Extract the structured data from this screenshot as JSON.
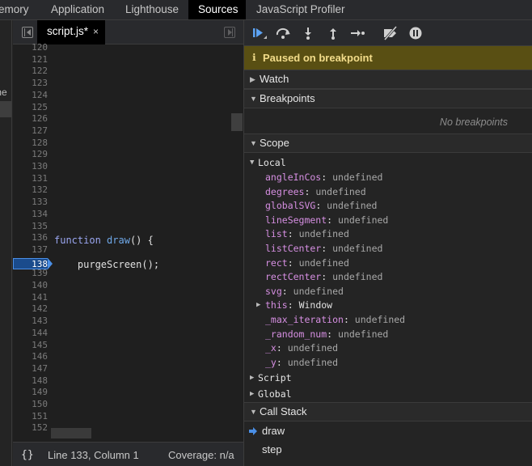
{
  "top_tabs": [
    {
      "label": "emory",
      "active": false
    },
    {
      "label": "Application",
      "active": false
    },
    {
      "label": "Lighthouse",
      "active": false
    },
    {
      "label": "Sources",
      "active": true
    },
    {
      "label": "JavaScript Profiler",
      "active": false
    }
  ],
  "left_fragment": "me",
  "editor": {
    "file_tab": "script.js*",
    "file_tab_close": "×",
    "line_numbers": [
      "120",
      "121",
      "122",
      "123",
      "124",
      "125",
      "126",
      "127",
      "128",
      "129",
      "130",
      "131",
      "132",
      "133",
      "134",
      "135",
      "136",
      "137",
      "138",
      "139",
      "140",
      "141",
      "142",
      "143",
      "144",
      "145",
      "146",
      "147",
      "148",
      "149",
      "150",
      "151",
      "152"
    ],
    "breakpoint_line": "138",
    "code": {
      "line136": {
        "kw": "function",
        "fn": "draw",
        "rest": "() {"
      },
      "line138": {
        "text": "    purgeScreen();"
      }
    }
  },
  "status": {
    "braces": "{}",
    "position": "Line 133, Column 1",
    "coverage": "Coverage: n/a"
  },
  "debugger": {
    "toolbar_icons": [
      "resume-icon",
      "step-over-icon",
      "step-into-icon",
      "step-out-icon",
      "step-icon",
      "deactivate-breakpoints-icon",
      "pause-on-exceptions-icon"
    ],
    "paused_icon": "ℹ",
    "paused_text": "Paused on breakpoint",
    "watch_label": "Watch",
    "breakpoints_label": "Breakpoints",
    "no_breakpoints": "No breakpoints",
    "scope_label": "Scope",
    "local_label": "Local",
    "local_vars": [
      {
        "name": "angleInCos",
        "value": "undefined"
      },
      {
        "name": "degrees",
        "value": "undefined"
      },
      {
        "name": "globalSVG",
        "value": "undefined"
      },
      {
        "name": "lineSegment",
        "value": "undefined"
      },
      {
        "name": "list",
        "value": "undefined"
      },
      {
        "name": "listCenter",
        "value": "undefined"
      },
      {
        "name": "rect",
        "value": "undefined"
      },
      {
        "name": "rectCenter",
        "value": "undefined"
      },
      {
        "name": "svg",
        "value": "undefined"
      },
      {
        "name": "this",
        "value": "Window"
      },
      {
        "name": "_max_iteration",
        "value": "undefined"
      },
      {
        "name": "_random_num",
        "value": "undefined"
      },
      {
        "name": "_x",
        "value": "undefined"
      },
      {
        "name": "_y",
        "value": "undefined"
      }
    ],
    "script_label": "Script",
    "global_label": "Global",
    "call_stack_label": "Call Stack",
    "frames": [
      "draw",
      "step"
    ]
  },
  "colors": {
    "paused_bg": "#594f13",
    "paused_text": "#f2dc8a",
    "accent_blue": "#4a8fe6",
    "var_name": "#d68fe2"
  }
}
